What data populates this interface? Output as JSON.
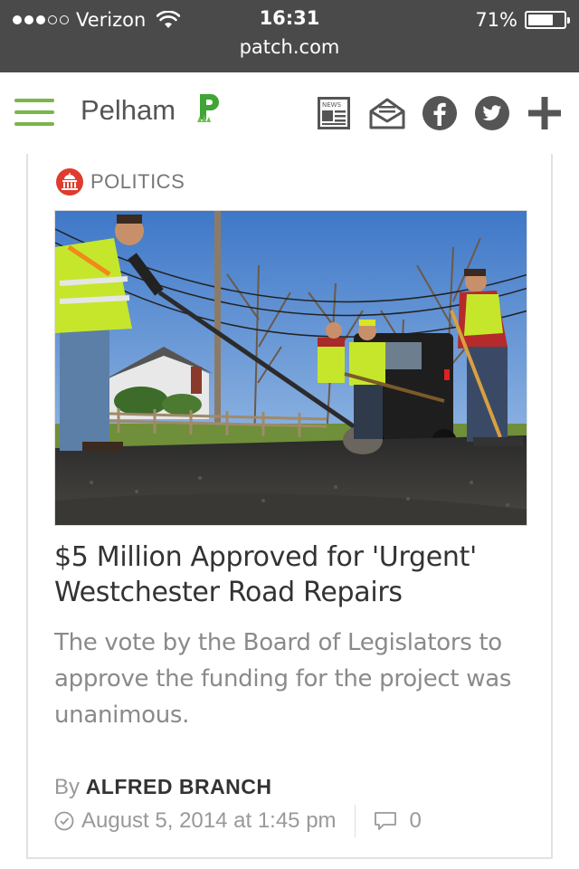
{
  "status_bar": {
    "carrier": "Verizon",
    "time": "16:31",
    "battery": "71%",
    "battery_level": 0.71,
    "signal_bars_filled": 3,
    "signal_bars_total": 5,
    "url": "patch.com"
  },
  "header": {
    "site_name": "Pelham",
    "logo_letter": "P",
    "accent_color": "#7ab648",
    "icons": [
      "menu-icon",
      "newsletter-icon",
      "email-icon",
      "facebook-icon",
      "twitter-icon",
      "plus-icon"
    ],
    "newspaper_icon_text": "NEWS"
  },
  "article": {
    "category": "POLITICS",
    "category_color": "#e03b2e",
    "headline": "$5 Million Approved for 'Urgent' Westchester Road Repairs",
    "summary": "The vote by the Board of Legislators to approve the funding for the project was unanimous.",
    "by_prefix": "By",
    "author": "ALFRED BRANCH",
    "date": "August 5, 2014 at 1:45 pm",
    "comment_count": "0"
  }
}
